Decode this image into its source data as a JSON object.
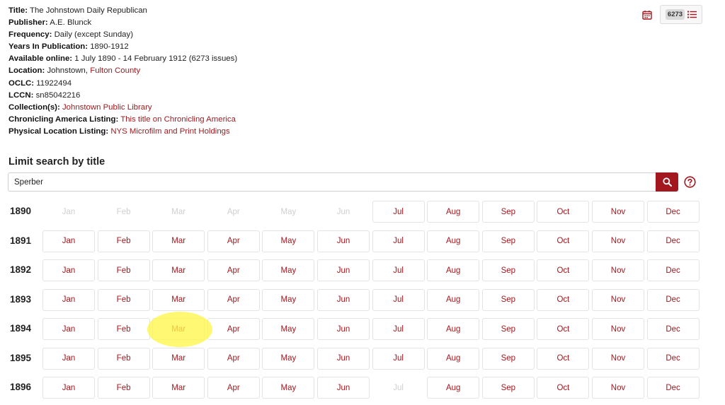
{
  "record": {
    "title": {
      "label": "Title:",
      "value": "The Johnstown Daily Republican"
    },
    "publisher": {
      "label": "Publisher:",
      "value": "A.E. Blunck"
    },
    "frequency": {
      "label": "Frequency:",
      "value": "Daily (except Sunday)"
    },
    "years": {
      "label": "Years In Publication:",
      "value": "1890-1912"
    },
    "available": {
      "label": "Available online:",
      "value": "1 July 1890 - 14 February 1912 (6273 issues)"
    },
    "location": {
      "label": "Location:",
      "value": "Johnstown,",
      "link": "Fulton County"
    },
    "oclc": {
      "label": "OCLC:",
      "value": "11922494"
    },
    "lccn": {
      "label": "LCCN:",
      "value": "sn85042216"
    },
    "collection": {
      "label": "Collection(s):",
      "link": "Johnstown Public Library"
    },
    "chronicling": {
      "label": "Chronicling America Listing:",
      "link": "This title on Chronicling America"
    },
    "physical": {
      "label": "Physical Location Listing:",
      "link": "NYS Microfilm and Print Holdings"
    }
  },
  "tools": {
    "calendar_icon": "calendar-icon",
    "issues_count": "6273",
    "list_icon": "list-icon"
  },
  "search": {
    "heading": "Limit search by title",
    "value": "Sperber",
    "button_icon": "search-icon",
    "help_icon": "help-circle-icon"
  },
  "highlight_color": "#fff64a",
  "accent_color": "#a3181e",
  "calendar": {
    "years": [
      {
        "year": "1890",
        "months": [
          {
            "label": "Jan",
            "enabled": false
          },
          {
            "label": "Feb",
            "enabled": false
          },
          {
            "label": "Mar",
            "enabled": false
          },
          {
            "label": "Apr",
            "enabled": false
          },
          {
            "label": "May",
            "enabled": false
          },
          {
            "label": "Jun",
            "enabled": false
          },
          {
            "label": "Jul",
            "enabled": true
          },
          {
            "label": "Aug",
            "enabled": true
          },
          {
            "label": "Sep",
            "enabled": true
          },
          {
            "label": "Oct",
            "enabled": true
          },
          {
            "label": "Nov",
            "enabled": true
          },
          {
            "label": "Dec",
            "enabled": true
          }
        ]
      },
      {
        "year": "1891",
        "months": [
          {
            "label": "Jan",
            "enabled": true
          },
          {
            "label": "Feb",
            "enabled": true
          },
          {
            "label": "Mar",
            "enabled": true
          },
          {
            "label": "Apr",
            "enabled": true
          },
          {
            "label": "May",
            "enabled": true
          },
          {
            "label": "Jun",
            "enabled": true
          },
          {
            "label": "Jul",
            "enabled": true
          },
          {
            "label": "Aug",
            "enabled": true
          },
          {
            "label": "Sep",
            "enabled": true
          },
          {
            "label": "Oct",
            "enabled": true
          },
          {
            "label": "Nov",
            "enabled": true
          },
          {
            "label": "Dec",
            "enabled": true
          }
        ]
      },
      {
        "year": "1892",
        "months": [
          {
            "label": "Jan",
            "enabled": true
          },
          {
            "label": "Feb",
            "enabled": true
          },
          {
            "label": "Mar",
            "enabled": true
          },
          {
            "label": "Apr",
            "enabled": true
          },
          {
            "label": "May",
            "enabled": true
          },
          {
            "label": "Jun",
            "enabled": true
          },
          {
            "label": "Jul",
            "enabled": true
          },
          {
            "label": "Aug",
            "enabled": true
          },
          {
            "label": "Sep",
            "enabled": true
          },
          {
            "label": "Oct",
            "enabled": true
          },
          {
            "label": "Nov",
            "enabled": true
          },
          {
            "label": "Dec",
            "enabled": true
          }
        ]
      },
      {
        "year": "1893",
        "months": [
          {
            "label": "Jan",
            "enabled": true
          },
          {
            "label": "Feb",
            "enabled": true
          },
          {
            "label": "Mar",
            "enabled": true
          },
          {
            "label": "Apr",
            "enabled": true
          },
          {
            "label": "May",
            "enabled": true
          },
          {
            "label": "Jun",
            "enabled": true
          },
          {
            "label": "Jul",
            "enabled": true
          },
          {
            "label": "Aug",
            "enabled": true
          },
          {
            "label": "Sep",
            "enabled": true
          },
          {
            "label": "Oct",
            "enabled": true
          },
          {
            "label": "Nov",
            "enabled": true
          },
          {
            "label": "Dec",
            "enabled": true
          }
        ]
      },
      {
        "year": "1894",
        "months": [
          {
            "label": "Jan",
            "enabled": true
          },
          {
            "label": "Feb",
            "enabled": true
          },
          {
            "label": "Mar",
            "enabled": true,
            "highlighted": true
          },
          {
            "label": "Apr",
            "enabled": true
          },
          {
            "label": "May",
            "enabled": true
          },
          {
            "label": "Jun",
            "enabled": true
          },
          {
            "label": "Jul",
            "enabled": true
          },
          {
            "label": "Aug",
            "enabled": true
          },
          {
            "label": "Sep",
            "enabled": true
          },
          {
            "label": "Oct",
            "enabled": true
          },
          {
            "label": "Nov",
            "enabled": true
          },
          {
            "label": "Dec",
            "enabled": true
          }
        ]
      },
      {
        "year": "1895",
        "months": [
          {
            "label": "Jan",
            "enabled": true
          },
          {
            "label": "Feb",
            "enabled": true
          },
          {
            "label": "Mar",
            "enabled": true
          },
          {
            "label": "Apr",
            "enabled": true
          },
          {
            "label": "May",
            "enabled": true
          },
          {
            "label": "Jun",
            "enabled": true
          },
          {
            "label": "Jul",
            "enabled": true
          },
          {
            "label": "Aug",
            "enabled": true
          },
          {
            "label": "Sep",
            "enabled": true
          },
          {
            "label": "Oct",
            "enabled": true
          },
          {
            "label": "Nov",
            "enabled": true
          },
          {
            "label": "Dec",
            "enabled": true
          }
        ]
      },
      {
        "year": "1896",
        "months": [
          {
            "label": "Jan",
            "enabled": true
          },
          {
            "label": "Feb",
            "enabled": true
          },
          {
            "label": "Mar",
            "enabled": true
          },
          {
            "label": "Apr",
            "enabled": true
          },
          {
            "label": "May",
            "enabled": true
          },
          {
            "label": "Jun",
            "enabled": true
          },
          {
            "label": "Jul",
            "enabled": false
          },
          {
            "label": "Aug",
            "enabled": true
          },
          {
            "label": "Sep",
            "enabled": true
          },
          {
            "label": "Oct",
            "enabled": true
          },
          {
            "label": "Nov",
            "enabled": true
          },
          {
            "label": "Dec",
            "enabled": true
          }
        ]
      }
    ]
  }
}
